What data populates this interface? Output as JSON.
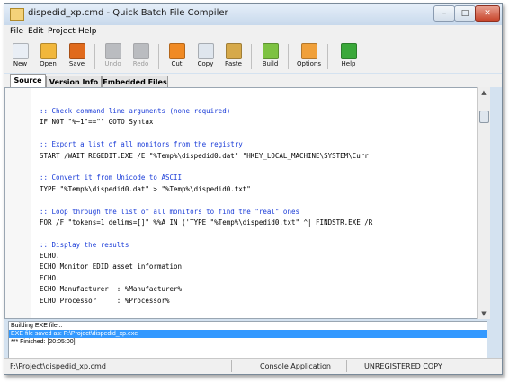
{
  "window": {
    "title": "dispedid_xp.cmd - Quick Batch File Compiler"
  },
  "menu": [
    "File",
    "Edit",
    "Project",
    "Help"
  ],
  "toolbar": {
    "buttons": [
      {
        "label": "New",
        "icon": "new-file-icon",
        "color": "#e9eef5",
        "enabled": true
      },
      {
        "label": "Open",
        "icon": "open-folder-icon",
        "color": "#f1b73c",
        "enabled": true
      },
      {
        "label": "Save",
        "icon": "save-disk-icon",
        "color": "#e06a1c",
        "enabled": true
      },
      {
        "label": "Undo",
        "icon": "undo-icon",
        "color": "#8e9299",
        "enabled": false
      },
      {
        "label": "Redo",
        "icon": "redo-icon",
        "color": "#8e9299",
        "enabled": false
      },
      {
        "label": "Cut",
        "icon": "scissors-icon",
        "color": "#f08a24",
        "enabled": true
      },
      {
        "label": "Copy",
        "icon": "copy-icon",
        "color": "#dfe6ee",
        "enabled": true
      },
      {
        "label": "Paste",
        "icon": "paste-icon",
        "color": "#d6a94a",
        "enabled": true
      },
      {
        "label": "Build",
        "icon": "build-icon",
        "color": "#7dc242",
        "enabled": true
      },
      {
        "label": "Options",
        "icon": "options-icon",
        "color": "#f0a03a",
        "enabled": true
      },
      {
        "label": "Help",
        "icon": "help-icon",
        "color": "#3aa83a",
        "enabled": true
      }
    ]
  },
  "tabs": [
    {
      "label": "Source",
      "active": true
    },
    {
      "label": "Version Info",
      "active": false
    },
    {
      "label": "Embedded Files",
      "active": false
    }
  ],
  "editor": {
    "lines": [
      {
        "text": ":: Check command line arguments (none required)",
        "kind": "comment"
      },
      {
        "text": "IF NOT \"%~1\"==\"\" GOTO Syntax",
        "kind": "normal"
      },
      {
        "text": "",
        "kind": "normal"
      },
      {
        "text": ":: Export a list of all monitors from the registry",
        "kind": "comment"
      },
      {
        "text": "START /WAIT REGEDIT.EXE /E \"%Temp%\\dispedid0.dat\" \"HKEY_LOCAL_MACHINE\\SYSTEM\\Curr",
        "kind": "normal"
      },
      {
        "text": "",
        "kind": "normal"
      },
      {
        "text": ":: Convert it from Unicode to ASCII",
        "kind": "comment"
      },
      {
        "text": "TYPE \"%Temp%\\dispedid0.dat\" > \"%Temp%\\dispedid0.txt\"",
        "kind": "normal"
      },
      {
        "text": "",
        "kind": "normal"
      },
      {
        "text": ":: Loop through the list of all monitors to find the \"real\" ones",
        "kind": "comment"
      },
      {
        "text": "FOR /F \"tokens=1 delims=[]\" %%A IN ('TYPE \"%Temp%\\dispedid0.txt\" ^| FINDSTR.EXE /R",
        "kind": "normal"
      },
      {
        "text": "",
        "kind": "normal"
      },
      {
        "text": ":: Display the results",
        "kind": "comment"
      },
      {
        "text": "ECHO.",
        "kind": "normal"
      },
      {
        "text": "ECHO Monitor EDID asset information",
        "kind": "normal"
      },
      {
        "text": "ECHO.",
        "kind": "normal"
      },
      {
        "text": "ECHO Manufacturer  : %Manufacturer%",
        "kind": "normal"
      },
      {
        "text": "ECHO Processor     : %Processor%",
        "kind": "normal"
      }
    ]
  },
  "output": {
    "lines": [
      {
        "text": "Building EXE file...",
        "selected": false
      },
      {
        "text": "EXE file saved as: F:\\Project\\dispedid_xp.exe",
        "selected": true
      },
      {
        "text": "*** Finished: [20:05:00]",
        "selected": false
      }
    ]
  },
  "status": {
    "path": "F:\\Project\\dispedid_xp.cmd",
    "type": "Console Application",
    "registration": "UNREGISTERED COPY"
  }
}
